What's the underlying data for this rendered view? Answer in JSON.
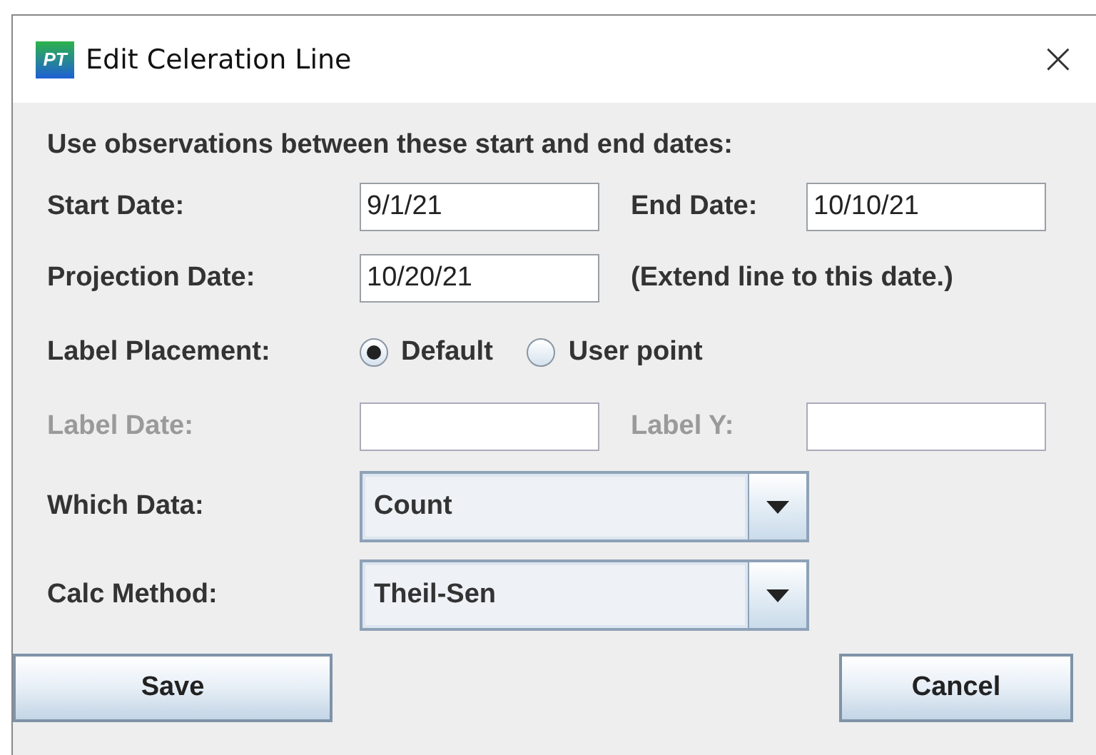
{
  "window": {
    "icon_text": "PT",
    "title": "Edit Celeration Line",
    "close": "×"
  },
  "intro": "Use observations between these start and end dates:",
  "start_date": {
    "label": "Start Date:",
    "value": "9/1/21",
    "disabled": false
  },
  "end_date": {
    "label": "End Date:",
    "value": "10/10/21",
    "disabled": false
  },
  "projection_date": {
    "label": "Projection Date:",
    "value": "10/20/21",
    "note": "(Extend line to this date.)"
  },
  "label_placement": {
    "label": "Label Placement:",
    "options": [
      {
        "label": "Default",
        "selected": true
      },
      {
        "label": "User point",
        "selected": false
      }
    ]
  },
  "label_date": {
    "label": "Label Date:",
    "disabled": true
  },
  "label_y": {
    "label": "Label Y:",
    "disabled": true
  },
  "which_data": {
    "label": "Which Data:",
    "value": "Count"
  },
  "calc_method": {
    "label": "Calc Method:",
    "value": "Theil-Sen"
  },
  "buttons": [
    {
      "label": "Save",
      "kind": "left"
    },
    {
      "label": "Cancel",
      "kind": "right"
    }
  ]
}
